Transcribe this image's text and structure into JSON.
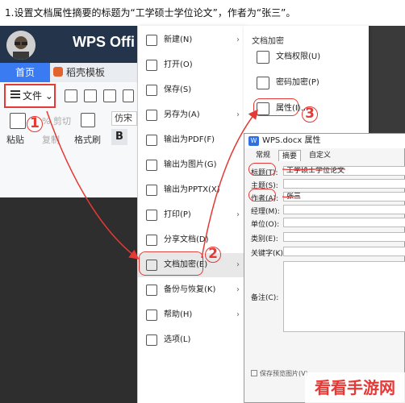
{
  "instruction": "1.设置文档属性摘要的标题为“工学硕士学位论文”，作者为“张三”。",
  "app": {
    "logo": "WPS Offi"
  },
  "tabs": {
    "home": "首页",
    "doke": "稻壳模板"
  },
  "toolbar": {
    "file_label": "文件",
    "cut_label": "% 剪切",
    "paste_label": "粘贴",
    "copy_label": "复制",
    "format_painter_label": "格式刷",
    "font_value": "仿宋",
    "bold_label": "B"
  },
  "file_menu": {
    "items": [
      {
        "label": "新建(N)",
        "submenu": true
      },
      {
        "label": "打开(O)",
        "submenu": false
      },
      {
        "label": "保存(S)",
        "submenu": false
      },
      {
        "label": "另存为(A)",
        "submenu": true
      },
      {
        "label": "输出为PDF(F)",
        "submenu": false
      },
      {
        "label": "输出为图片(G)",
        "submenu": false
      },
      {
        "label": "输出为PPTX(X)",
        "submenu": false
      },
      {
        "label": "打印(P)",
        "submenu": true
      },
      {
        "label": "分享文档(D)",
        "submenu": false
      },
      {
        "label": "文档加密(E)",
        "submenu": true
      },
      {
        "label": "备份与恢复(K)",
        "submenu": true
      },
      {
        "label": "帮助(H)",
        "submenu": true
      },
      {
        "label": "选项(L)",
        "submenu": false
      }
    ]
  },
  "submenu": {
    "title": "文档加密",
    "items": [
      "文档权限(U)",
      "密码加密(P)",
      "属性(I)..."
    ]
  },
  "dialog": {
    "title": "WPS.docx 属性",
    "tabs": [
      "常规",
      "摘要",
      "自定义"
    ],
    "fields": {
      "title_label": "标题(T):",
      "title_value": "工学硕士学位论文",
      "subject_label": "主题(S):",
      "author_label": "作者(A):",
      "author_value": "张三",
      "manager_label": "经理(M):",
      "company_label": "单位(O):",
      "category_label": "类别(E):",
      "keywords_label": "关键字(K):",
      "comments_label": "备注(C):",
      "preview_checkbox": "保存预览图片(V)"
    }
  },
  "annotations": {
    "n1": "1",
    "n2": "2",
    "n3": "3"
  },
  "watermark": "看看手游网",
  "colors": {
    "accent": "#3b7bf2",
    "annotation": "#e53935",
    "titlebar": "#24344a"
  }
}
